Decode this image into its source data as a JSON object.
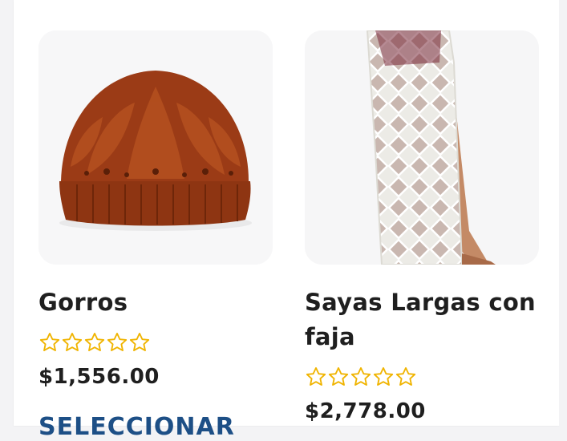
{
  "products": [
    {
      "name": "Gorros",
      "price": "$1,556.00",
      "rating": 0,
      "button_label": "SELECCIONAR"
    },
    {
      "name": "Sayas Largas con faja",
      "price": "$2,778.00",
      "rating": 0
    }
  ],
  "colors": {
    "star_outline": "#f0b400",
    "button_text": "#1d4f86",
    "title_text": "#1f1f1f"
  }
}
